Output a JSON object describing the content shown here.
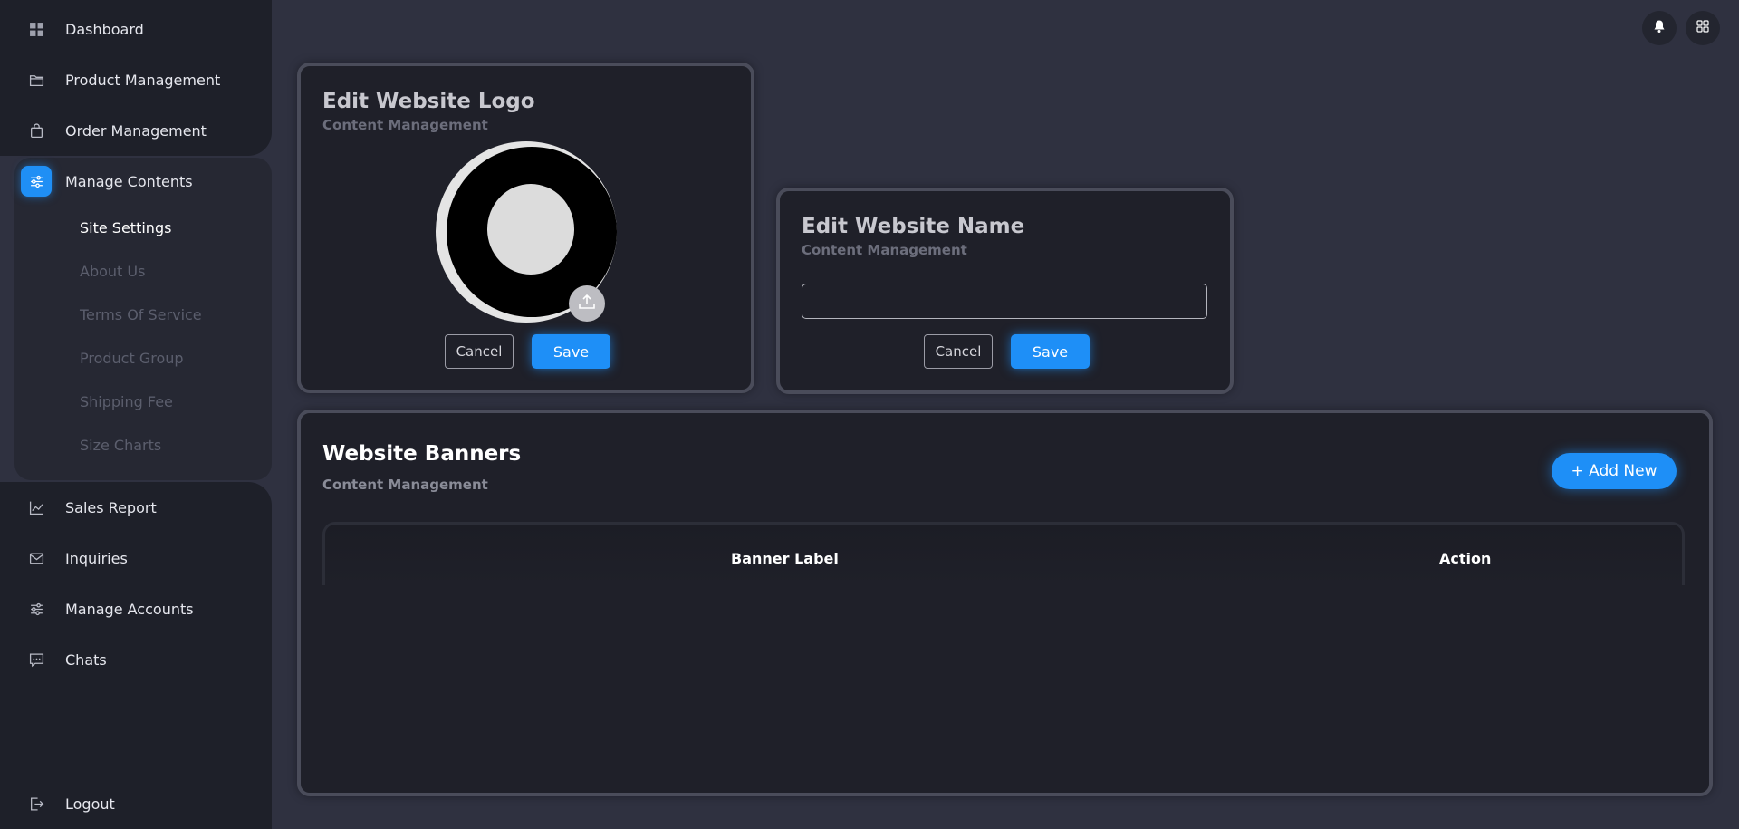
{
  "sidebar": {
    "items": [
      {
        "label": "Dashboard",
        "icon": "dashboard-icon"
      },
      {
        "label": "Product Management",
        "icon": "folder-icon"
      },
      {
        "label": "Order Management",
        "icon": "shopping-bag-icon"
      },
      {
        "label": "Manage Contents",
        "icon": "sliders-icon",
        "active": true
      },
      {
        "label": "Sales Report",
        "icon": "line-chart-icon"
      },
      {
        "label": "Inquiries",
        "icon": "mail-icon"
      },
      {
        "label": "Manage Accounts",
        "icon": "sliders-icon"
      },
      {
        "label": "Chats",
        "icon": "chat-icon"
      },
      {
        "label": "Logout",
        "icon": "logout-icon"
      }
    ],
    "sub_items": [
      {
        "label": "Site Settings",
        "active": true
      },
      {
        "label": "About Us"
      },
      {
        "label": "Terms Of Service"
      },
      {
        "label": "Product Group"
      },
      {
        "label": "Shipping Fee"
      },
      {
        "label": "Size Charts"
      }
    ]
  },
  "header": {
    "icons": [
      "bell-icon",
      "grid-icon"
    ]
  },
  "logo_card": {
    "title": "Edit Website Logo",
    "subtitle": "Content Management",
    "cancel_label": "Cancel",
    "save_label": "Save"
  },
  "name_card": {
    "title": "Edit Website Name",
    "subtitle": "Content Management",
    "input_value": "",
    "input_placeholder": "",
    "cancel_label": "Cancel",
    "save_label": "Save"
  },
  "banners": {
    "title": "Website Banners",
    "subtitle": "Content Management",
    "add_label": "+ Add New",
    "columns": [
      "Banner Label",
      "Action"
    ],
    "rows": []
  },
  "colors": {
    "accent": "#1e8ff7",
    "background": "#2f3140",
    "panel": "#1f2029"
  }
}
